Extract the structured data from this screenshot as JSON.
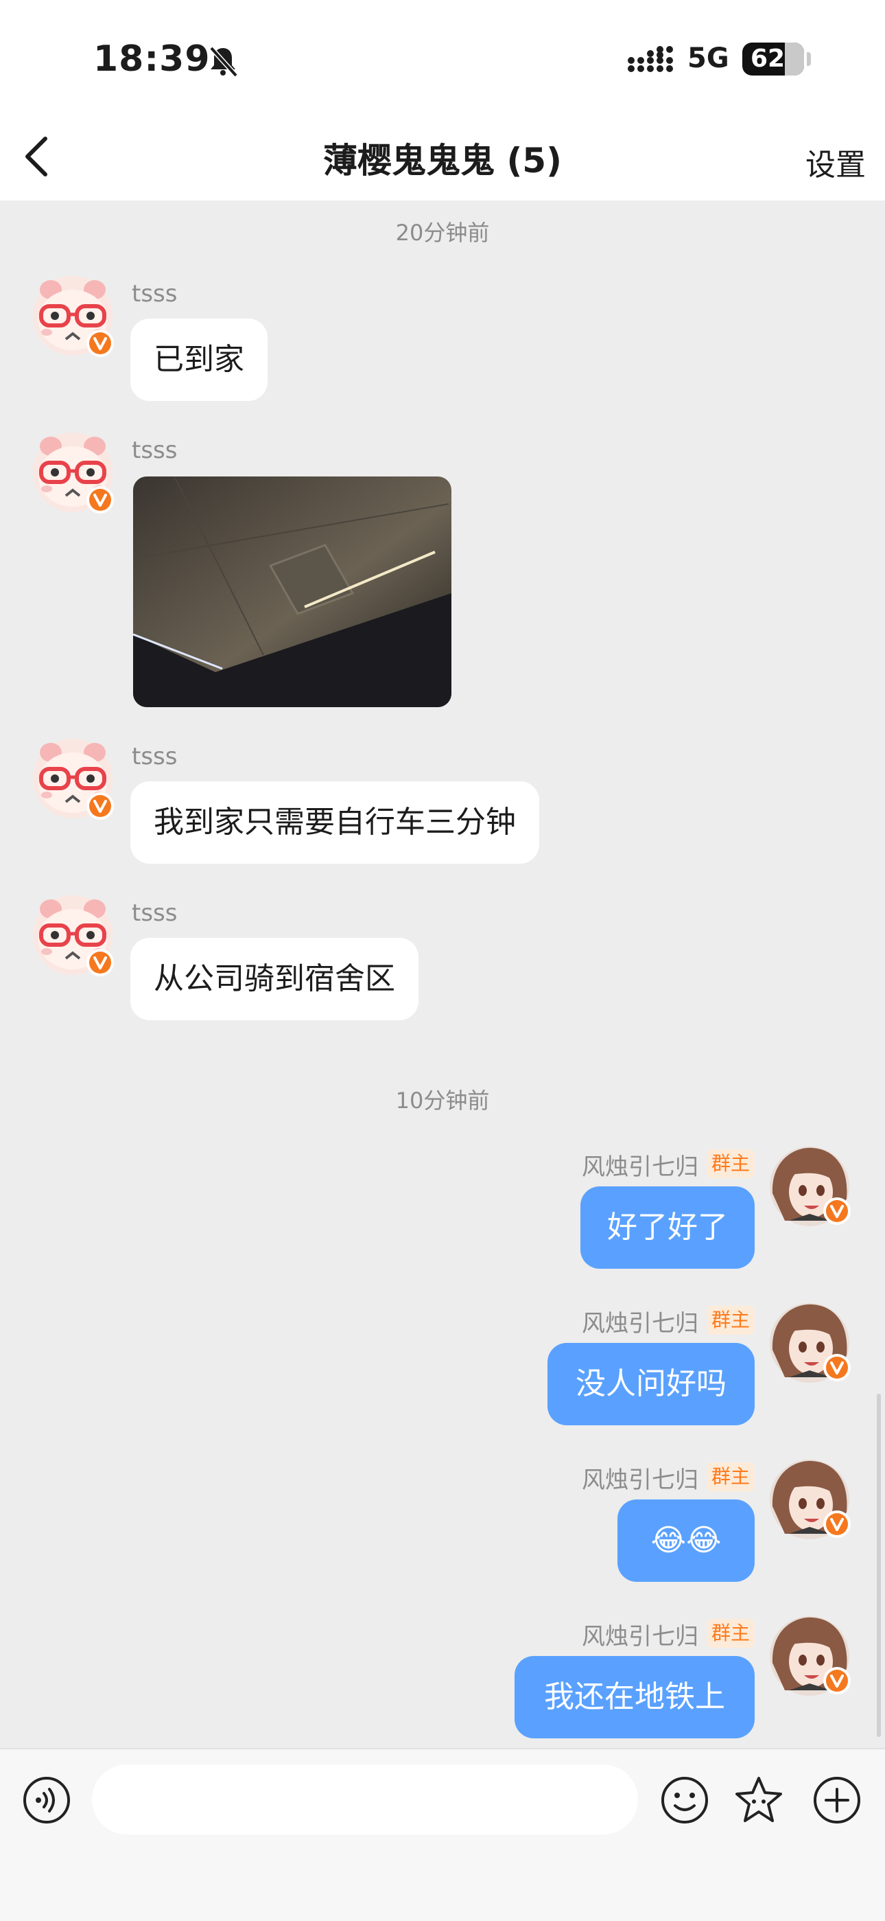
{
  "status_bar": {
    "time": "18:39",
    "network": "5G",
    "battery": "62"
  },
  "header": {
    "title": "薄樱鬼鬼鬼 (5)",
    "settings_label": "设置"
  },
  "chat": {
    "timestamps": [
      "20分钟前",
      "10分钟前"
    ],
    "messages": [
      {
        "sender": "tsss",
        "text": "已到家",
        "type": "text"
      },
      {
        "sender": "tsss",
        "type": "image"
      },
      {
        "sender": "tsss",
        "text": "我到家只需要自行车三分钟",
        "type": "text"
      },
      {
        "sender": "tsss",
        "text": "从公司骑到宿舍区",
        "type": "text"
      },
      {
        "sender": "风烛引七归",
        "role_tag": "群主",
        "text": "好了好了",
        "type": "text"
      },
      {
        "sender": "风烛引七归",
        "role_tag": "群主",
        "text": "没人问好吗",
        "type": "text"
      },
      {
        "sender": "风烛引七归",
        "role_tag": "群主",
        "text": "😂😂",
        "type": "text"
      },
      {
        "sender": "风烛引七归",
        "role_tag": "群主",
        "text": "我还在地铁上",
        "type": "text"
      }
    ]
  },
  "input_bar": {
    "placeholder": "",
    "icons": [
      "voice-icon",
      "emoji-icon",
      "sticker-star-icon",
      "add-icon"
    ]
  },
  "colors": {
    "outgoing_bubble": "#5aa1ff",
    "incoming_bubble": "#ffffff",
    "badge": "#f5781e",
    "owner_tag": "#ff7a1a"
  }
}
